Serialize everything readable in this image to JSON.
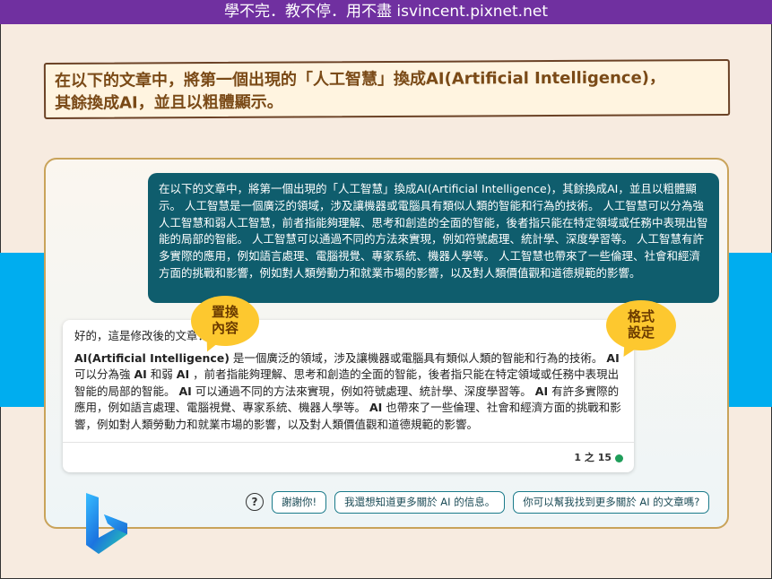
{
  "header": {
    "watermark": "學不完．教不停．用不盡 isvincent.pixnet.net"
  },
  "prompt": {
    "line1": "在以下的文章中，將第一個出現的「人工智慧」換成AI(Artificial  Intelligence)，",
    "line2": "其餘換成AI，並且以粗體顯示。"
  },
  "user_message": {
    "text": "在以下的文章中，將第一個出現的「人工智慧」換成AI(Artificial Intelligence)，其餘換成AI，並且以粗體顯示。 人工智慧是一個廣泛的領域，涉及讓機器或電腦具有類似人類的智能和行為的技術。 人工智慧可以分為強人工智慧和弱人工智慧，前者指能夠理解、思考和創造的全面的智能，後者指只能在特定領域或任務中表現出智能的局部的智能。 人工智慧可以通過不同的方法來實現，例如符號處理、統計學、深度學習等。 人工智慧有許多實際的應用，例如語言處理、電腦視覺、專家系統、機器人學等。 人工智慧也帶來了一些倫理、社會和經濟方面的挑戰和影響，例如對人類勞動力和就業市場的影響，以及對人類價值觀和道德規範的影響。"
  },
  "ai_message": {
    "greeting": "好的，這是修改後的文章：",
    "b1": "AI(Artificial Intelligence)",
    "t1": " 是一個廣泛的領域，涉及讓機器或電腦具有類似人類的智能和行為的技術。 ",
    "b2": "AI",
    "t2": " 可以分為強 ",
    "b3": "AI",
    "t3": " 和弱 ",
    "b4": "AI",
    "t4": " ，前者指能夠理解、思考和創造的全面的智能，後者指只能在特定領域或任務中表現出智能的局部的智能。 ",
    "b5": "AI",
    "t5": " 可以通過不同的方法來實現，例如符號處理、統計學、深度學習等。 ",
    "b6": "AI",
    "t6": " 有許多實際的應用，例如語言處理、電腦視覺、專家系統、機器人學等。 ",
    "b7": "AI",
    "t7": " 也帶來了一些倫理、社會和經濟方面的挑戰和影響，例如對人類勞動力和就業市場的影響，以及對人類價值觀和道德規範的影響。",
    "counter": "1 之 15",
    "status_color": "#1f9e5a"
  },
  "callouts": {
    "left": [
      "置換",
      "內容"
    ],
    "right": [
      "格式",
      "設定"
    ]
  },
  "suggestions": {
    "help_icon": "question-circle-icon",
    "chip1": "謝謝你!",
    "chip2": "我還想知道更多關於 AI 的信息。",
    "chip3": "你可以幫我找到更多關於 AI 的文章嗎?"
  },
  "logo": {
    "name": "bing-logo-icon"
  },
  "colors": {
    "header_bg": "#7030a0",
    "band": "#00adef",
    "user_bubble": "#0f5d6d",
    "callout": "#fdc82f",
    "chip_border": "#1a7a8a"
  }
}
